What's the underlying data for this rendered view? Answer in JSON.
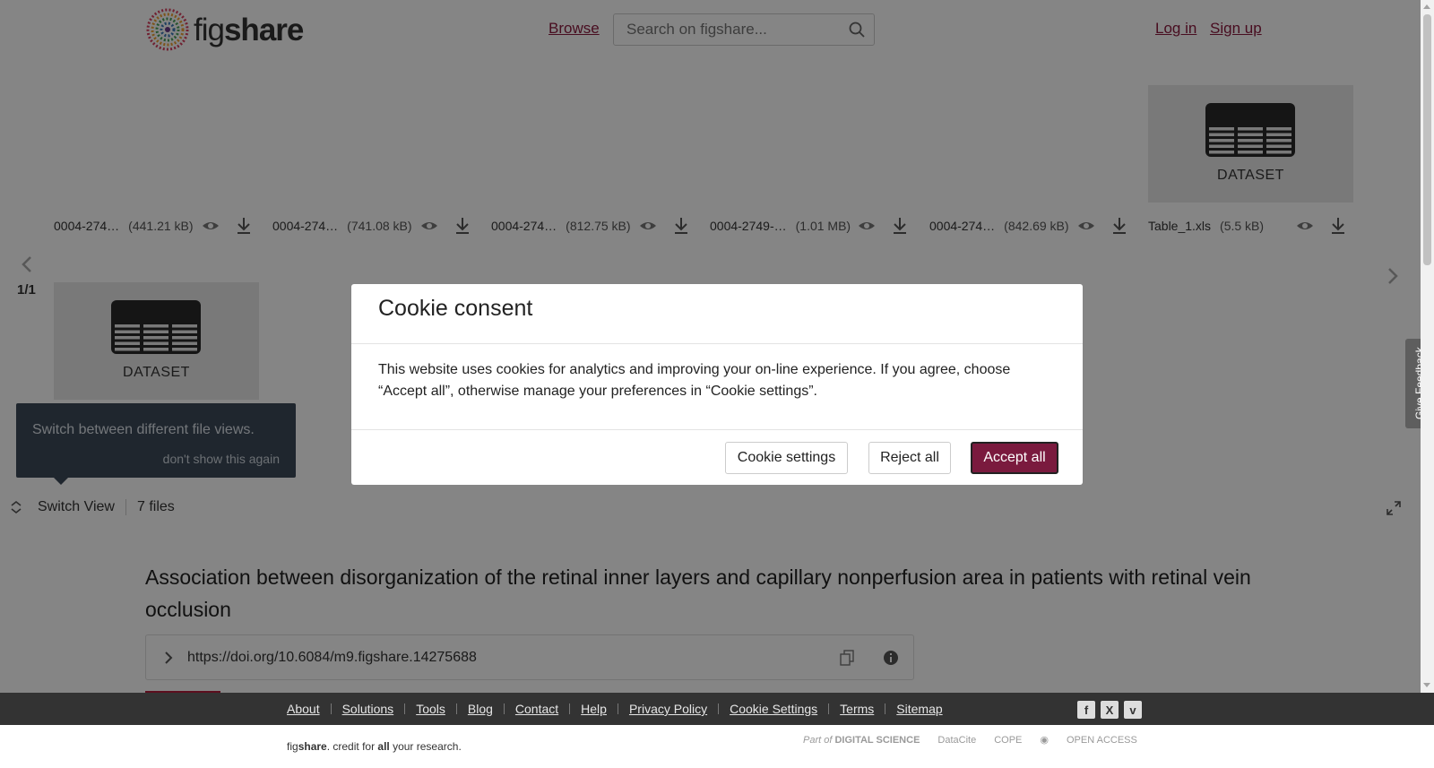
{
  "header": {
    "logo_text_light": "fig",
    "logo_text_bold": "share",
    "browse": "Browse",
    "search_placeholder": "Search on figshare...",
    "login": "Log in",
    "signup": "Sign up"
  },
  "viewer": {
    "files": [
      {
        "name": "0004-274…",
        "size": "(441.21 kB)"
      },
      {
        "name": "0004-274…",
        "size": "(741.08 kB)"
      },
      {
        "name": "0004-274…",
        "size": "(812.75 kB)"
      },
      {
        "name": "0004-2749-…",
        "size": "(1.01 MB)"
      },
      {
        "name": "0004-274…",
        "size": "(842.69 kB)"
      },
      {
        "name": "Table_1.xls",
        "size": "(5.5 kB)"
      }
    ],
    "dataset_label": "DATASET",
    "counter": "1/1",
    "tooltip_text": "Switch between different file views.",
    "tooltip_dismiss": "don't show this again",
    "switch_view": "Switch View",
    "file_count": "7 files"
  },
  "article": {
    "title": "Association between disorganization of the retinal inner layers and capillary nonperfusion area in patients with retinal vein occlusion",
    "doi": "https://doi.org/10.6084/m9.figshare.14275688"
  },
  "cookie_modal": {
    "title": "Cookie consent",
    "body": "This website uses cookies for analytics and improving your on-line experience. If you agree, choose “Accept all”, otherwise manage your preferences in “Cookie settings”.",
    "settings": "Cookie settings",
    "reject": "Reject all",
    "accept": "Accept all"
  },
  "feedback": "Give Feedback",
  "footer": {
    "links": [
      "About",
      "Solutions",
      "Tools",
      "Blog",
      "Contact",
      "Help",
      "Privacy Policy",
      "Cookie Settings",
      "Terms",
      "Sitemap"
    ],
    "tagline_pre": "fig",
    "tagline_bold": "share",
    "tagline_mid": ". credit for ",
    "tagline_all": "all",
    "tagline_post": " your research.",
    "partner_prefix": "Part of",
    "partners": [
      "DIGITAL SCIENCE",
      "DataCite",
      "COPE",
      "OPEN ACCESS"
    ]
  },
  "colors": {
    "brand": "#8b1a3f",
    "accept_button": "#7a1a3e",
    "tooltip_bg": "#3c4a59"
  }
}
